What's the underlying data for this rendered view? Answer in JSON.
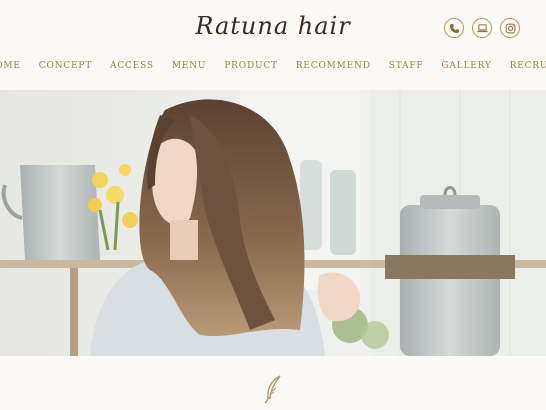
{
  "header": {
    "logo": "Ratuna hair",
    "icons": [
      "phone-icon",
      "laptop-icon",
      "instagram-icon"
    ],
    "accent_color": "#b89a5a"
  },
  "nav": {
    "items": [
      "HOME",
      "CONCEPT",
      "ACCESS",
      "MENU",
      "PRODUCT",
      "RECOMMEND",
      "STAFF",
      "GALLERY",
      "RECRUIT"
    ]
  },
  "hero": {
    "image": "woman-with-long-wavy-hair-photo"
  },
  "decor": {
    "icon": "feather-quill-icon"
  }
}
